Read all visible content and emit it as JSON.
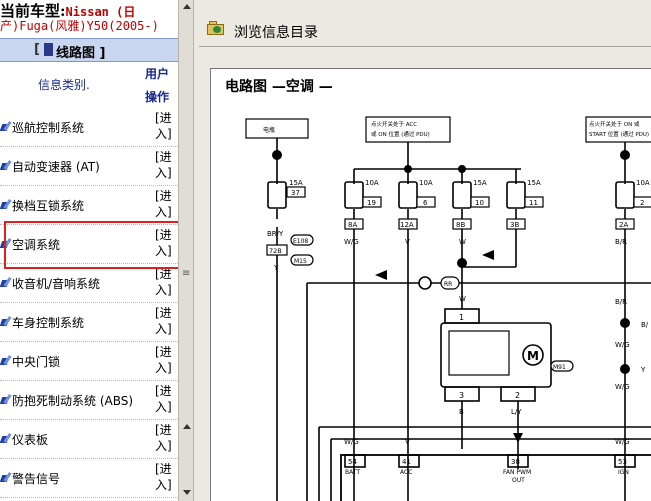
{
  "vehicle": {
    "label": "当前车型:",
    "name_part1": "Nissan (日",
    "name_part2": "产)Fuga(风雅)Y50(2005-)"
  },
  "left_panel": {
    "title": "线路图",
    "bracket_open": "[",
    "bracket_close": "]",
    "column_category": "信息类别.",
    "column_user": "用户",
    "column_op": "操作",
    "action_top": "[进",
    "action_bottom": "入]",
    "items": [
      {
        "label": "巡航控制系统"
      },
      {
        "label": "自动变速器 (AT)"
      },
      {
        "label": "换档互锁系统"
      },
      {
        "label": "空调系统"
      },
      {
        "label": "收音机/音响系统"
      },
      {
        "label": "车身控制系统"
      },
      {
        "label": "中央门锁"
      },
      {
        "label": "防抱死制动系统 (ABS)"
      },
      {
        "label": "仪表板"
      },
      {
        "label": "警告信号"
      }
    ],
    "highlight_color": "#e02020",
    "accent_color": "#1a2a8c"
  },
  "right_panel": {
    "header_title": "浏览信息目录",
    "doc_title": "电路图 —空调 —",
    "boxes": {
      "battery": "电瓶",
      "acc": "点火开关处于 ACC\n或 ON 位置 (通过 PDU)",
      "start": "点火开关处于 ON 或\nSTART 位置 (通过 PDU)"
    },
    "fuses": [
      {
        "amp": "15A",
        "num": "37"
      },
      {
        "amp": "10A",
        "num": "19"
      },
      {
        "amp": "10A",
        "num": "6"
      },
      {
        "amp": "15A",
        "num": "10"
      },
      {
        "amp": "15A",
        "num": "11"
      },
      {
        "amp": "10A",
        "num": "2"
      }
    ],
    "connectors": [
      "8A",
      "12A",
      "8B",
      "3B",
      "2A",
      "72B"
    ],
    "connector_refs": [
      "E108",
      "M15",
      "M91"
    ],
    "wire_colors": [
      "BR/Y",
      "Y",
      "W/G",
      "V",
      "W",
      "B",
      "L/Y",
      "B/R"
    ],
    "pins": [
      "1",
      "2",
      "3"
    ],
    "bottom_pins": [
      {
        "num": "54",
        "name": "BATT"
      },
      {
        "num": "41",
        "name": "ACC"
      },
      {
        "num": "38",
        "name": "FAN PWM\nOUT"
      },
      {
        "num": "53",
        "name": "IGN"
      }
    ],
    "motor_symbol": "M",
    "splice_label": "RR",
    "side_marks": [
      "B/",
      "Y"
    ]
  }
}
